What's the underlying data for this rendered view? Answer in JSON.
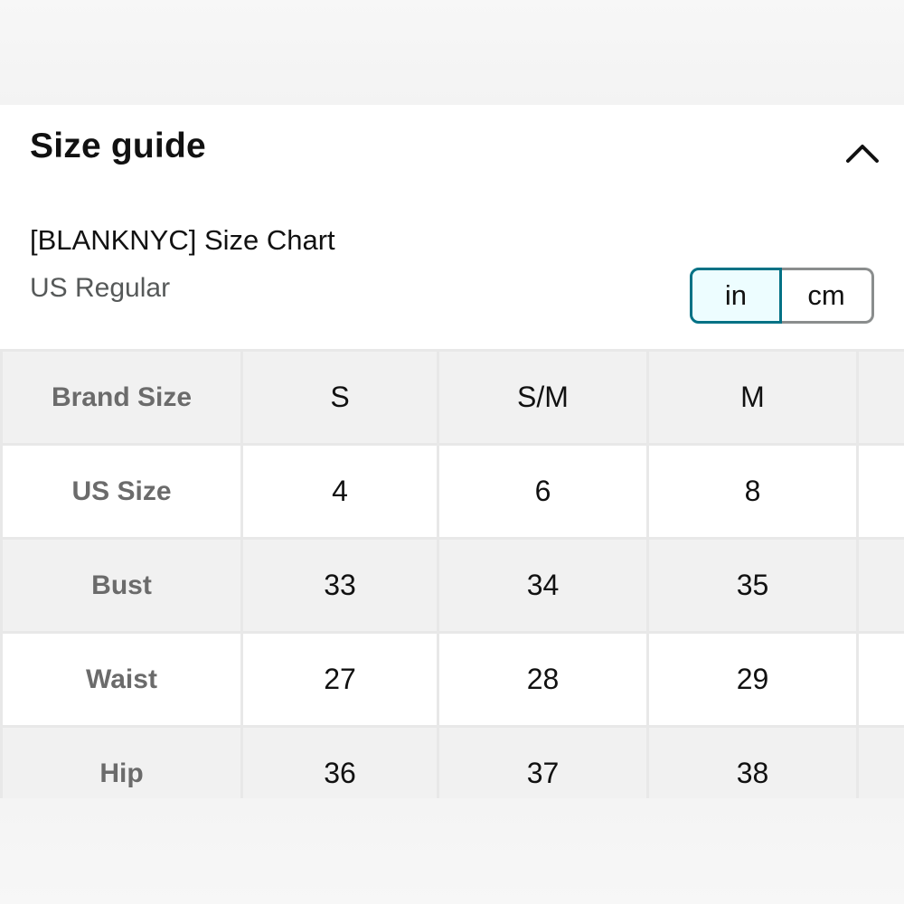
{
  "header": {
    "title": "Size guide",
    "collapse_icon": "chevron-up-icon"
  },
  "chart": {
    "title": "[BLANKNYC] Size Chart",
    "region": "US Regular"
  },
  "units": {
    "options": [
      "in",
      "cm"
    ],
    "selected": "in"
  },
  "colors": {
    "accent": "#007185",
    "active_bg": "#edfdff",
    "row_shade": "#f1f1f1",
    "label_gray": "#6b6b6b"
  },
  "table": {
    "rows": [
      {
        "label": "Brand Size",
        "values": [
          "S",
          "S/M",
          "M",
          ""
        ]
      },
      {
        "label": "US Size",
        "values": [
          "4",
          "6",
          "8",
          ""
        ]
      },
      {
        "label": "Bust",
        "values": [
          "33",
          "34",
          "35",
          ""
        ]
      },
      {
        "label": "Waist",
        "values": [
          "27",
          "28",
          "29",
          ""
        ]
      },
      {
        "label": "Hip",
        "values": [
          "36",
          "37",
          "38",
          ""
        ]
      }
    ]
  }
}
